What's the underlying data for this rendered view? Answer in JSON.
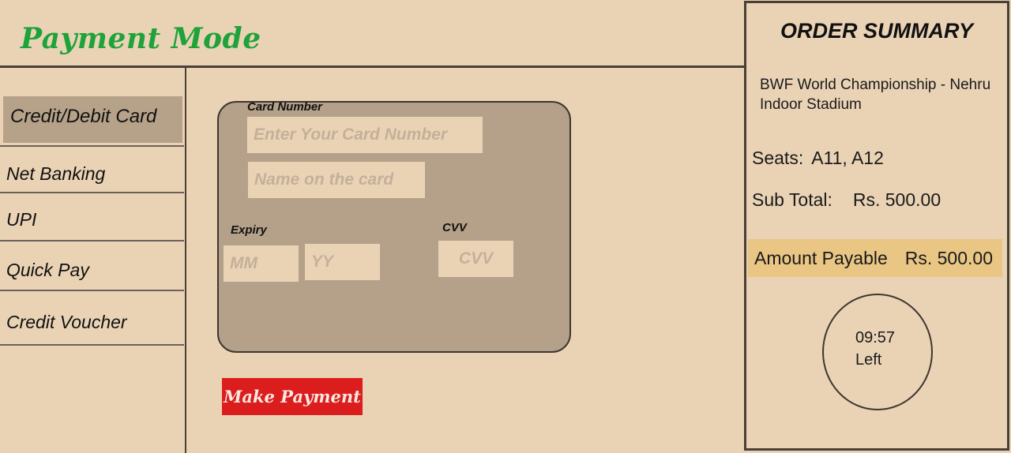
{
  "header": {
    "title": "Payment Mode"
  },
  "sidebar": {
    "items": [
      {
        "label": "Credit/Debit Card",
        "selected": true
      },
      {
        "label": "Net Banking",
        "selected": false
      },
      {
        "label": "UPI",
        "selected": false
      },
      {
        "label": "Quick Pay",
        "selected": false
      },
      {
        "label": "Credit Voucher",
        "selected": false
      }
    ]
  },
  "card_form": {
    "card_number_label": "Card Number",
    "card_number_placeholder": "Enter Your Card Number",
    "name_placeholder": "Name on the card",
    "expiry_label": "Expiry",
    "month_placeholder": "MM",
    "year_placeholder": "YY",
    "cvv_label": "CVV",
    "cvv_placeholder": "CVV",
    "submit_label": "Make Payment"
  },
  "order_summary": {
    "title": "ORDER SUMMARY",
    "event_name": "BWF World Championship - Nehru Indoor Stadium",
    "seats_label": "Seats:",
    "seats_value": "A11, A12",
    "subtotal_label": "Sub Total:",
    "subtotal_value": "Rs. 500.00",
    "payable_label": "Amount Payable",
    "payable_value": "Rs. 500.00",
    "timer_value": "09:57",
    "timer_label": "Left"
  },
  "colors": {
    "background": "#ead3b5",
    "title_green": "#1fa23a",
    "panel": "#b5a189",
    "button_red": "#dc1d1d",
    "payable_highlight": "#eac685"
  }
}
